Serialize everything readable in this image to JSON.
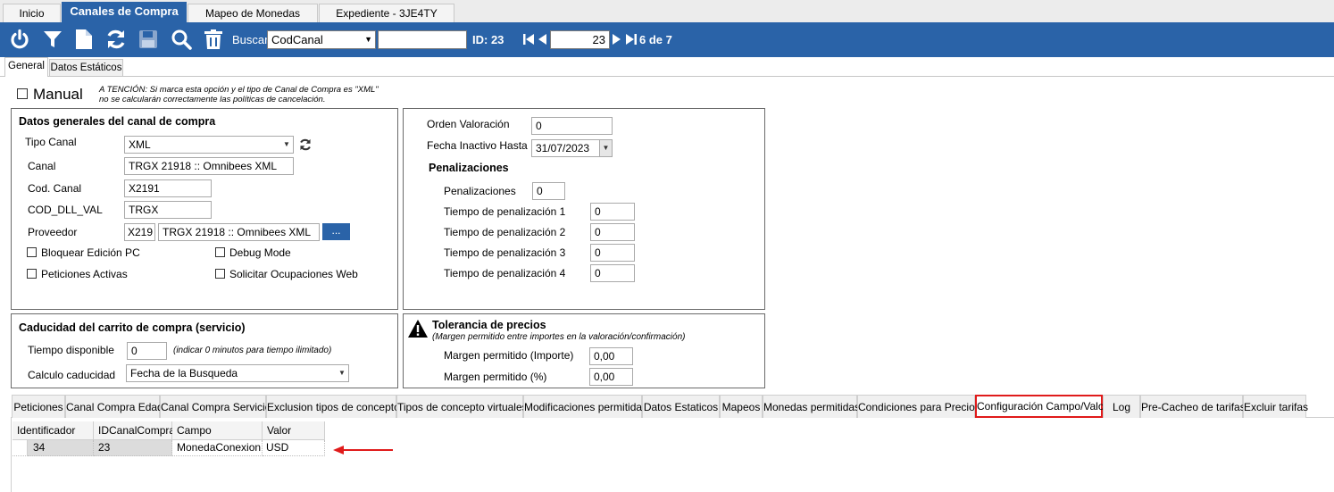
{
  "top_tabs": [
    {
      "label": "Inicio"
    },
    {
      "label": "Canales de Compra"
    },
    {
      "label": "Mapeo de Monedas"
    },
    {
      "label": "Expediente  - 3JE4TY"
    }
  ],
  "toolbar": {
    "icons": [
      "power-icon",
      "filter-icon",
      "new-document-icon",
      "refresh-icon",
      "save-icon",
      "search-icon",
      "delete-icon"
    ],
    "search_label": "Buscar",
    "search_field": "CodCanal",
    "search_value": "",
    "id_label": "ID: 23",
    "record_value": "23",
    "record_count": "6 de 7"
  },
  "sub_tabs": [
    {
      "label": "General"
    },
    {
      "label": "Datos Estáticos"
    }
  ],
  "manual": {
    "label": "Manual",
    "warning_line1": "A TENCIÓN: Si marca esta opción y el tipo de Canal de Compra es \"XML\"",
    "warning_line2": "no se calcularán correctamente las políticas de cancelación."
  },
  "general_panel": {
    "title": "Datos generales del canal de compra",
    "tipo_canal_label": "Tipo Canal",
    "tipo_canal_value": "XML",
    "canal_label": "Canal",
    "canal_value": "TRGX 21918 :: Omnibees XML",
    "cod_canal_label": "Cod. Canal",
    "cod_canal_value": "X2191",
    "cod_dll_label": "COD_DLL_VAL",
    "cod_dll_value": "TRGX",
    "proveedor_label": "Proveedor",
    "proveedor_code": "X219",
    "proveedor_name": "TRGX 21918 :: Omnibees XML",
    "browse_label": "...",
    "checkboxes": {
      "bloquear": "Bloquear Edición PC",
      "debug": "Debug Mode",
      "peticiones": "Peticiones Activas",
      "solicitar": "Solicitar Ocupaciones Web"
    }
  },
  "valoracion_panel": {
    "orden_label": "Orden Valoración",
    "orden_value": "0",
    "fecha_label": "Fecha Inactivo Hasta",
    "fecha_value": "31/07/2023",
    "penalizaciones_title": "Penalizaciones",
    "penalizaciones_label": "Penalizaciones",
    "penalizaciones_value": "0",
    "tiempos": [
      {
        "label": "Tiempo de penalización 1",
        "value": "0"
      },
      {
        "label": "Tiempo de penalización 2",
        "value": "0"
      },
      {
        "label": "Tiempo de penalización 3",
        "value": "0"
      },
      {
        "label": "Tiempo de penalización 4",
        "value": "0"
      }
    ]
  },
  "caducidad_panel": {
    "title": "Caducidad del carrito de compra (servicio)",
    "tiempo_label": "Tiempo disponible",
    "tiempo_value": "0",
    "tiempo_hint": "(indicar 0 minutos para tiempo ilimitado)",
    "calculo_label": "Calculo caducidad",
    "calculo_value": "Fecha de la Busqueda"
  },
  "tolerancia_panel": {
    "title": "Tolerancia de precios",
    "subtitle": "(Margen permitido entre importes en la valoración/confirmación)",
    "margen_importe_label": "Margen permitido (Importe)",
    "margen_importe_value": "0,00",
    "margen_pct_label": "Margen permitido (%)",
    "margen_pct_value": "0,00"
  },
  "bottom_tabs": [
    {
      "label": "Peticiones"
    },
    {
      "label": "Canal Compra Edad"
    },
    {
      "label": "Canal Compra Servicio"
    },
    {
      "label": "Exclusion tipos de concepto"
    },
    {
      "label": "Tipos de concepto virtuales"
    },
    {
      "label": "Modificaciones permitidas"
    },
    {
      "label": "Datos Estaticos"
    },
    {
      "label": "Mapeos"
    },
    {
      "label": "Monedas permitidas"
    },
    {
      "label": "Condiciones para Precios"
    },
    {
      "label": "Configuración Campo/Valor"
    },
    {
      "label": "Log"
    },
    {
      "label": "Pre-Cacheo de tarifas"
    },
    {
      "label": "Excluir tarifas"
    }
  ],
  "grid": {
    "columns": [
      "Identificador",
      "IDCanalCompra",
      "Campo",
      "Valor"
    ],
    "rows": [
      [
        "34",
        "23",
        "MonedaConexion",
        "USD"
      ]
    ]
  },
  "colors": {
    "toolbar_bg": "#2a63a8",
    "highlight_border": "#e01b1b",
    "arrow": "#e01b1b"
  }
}
